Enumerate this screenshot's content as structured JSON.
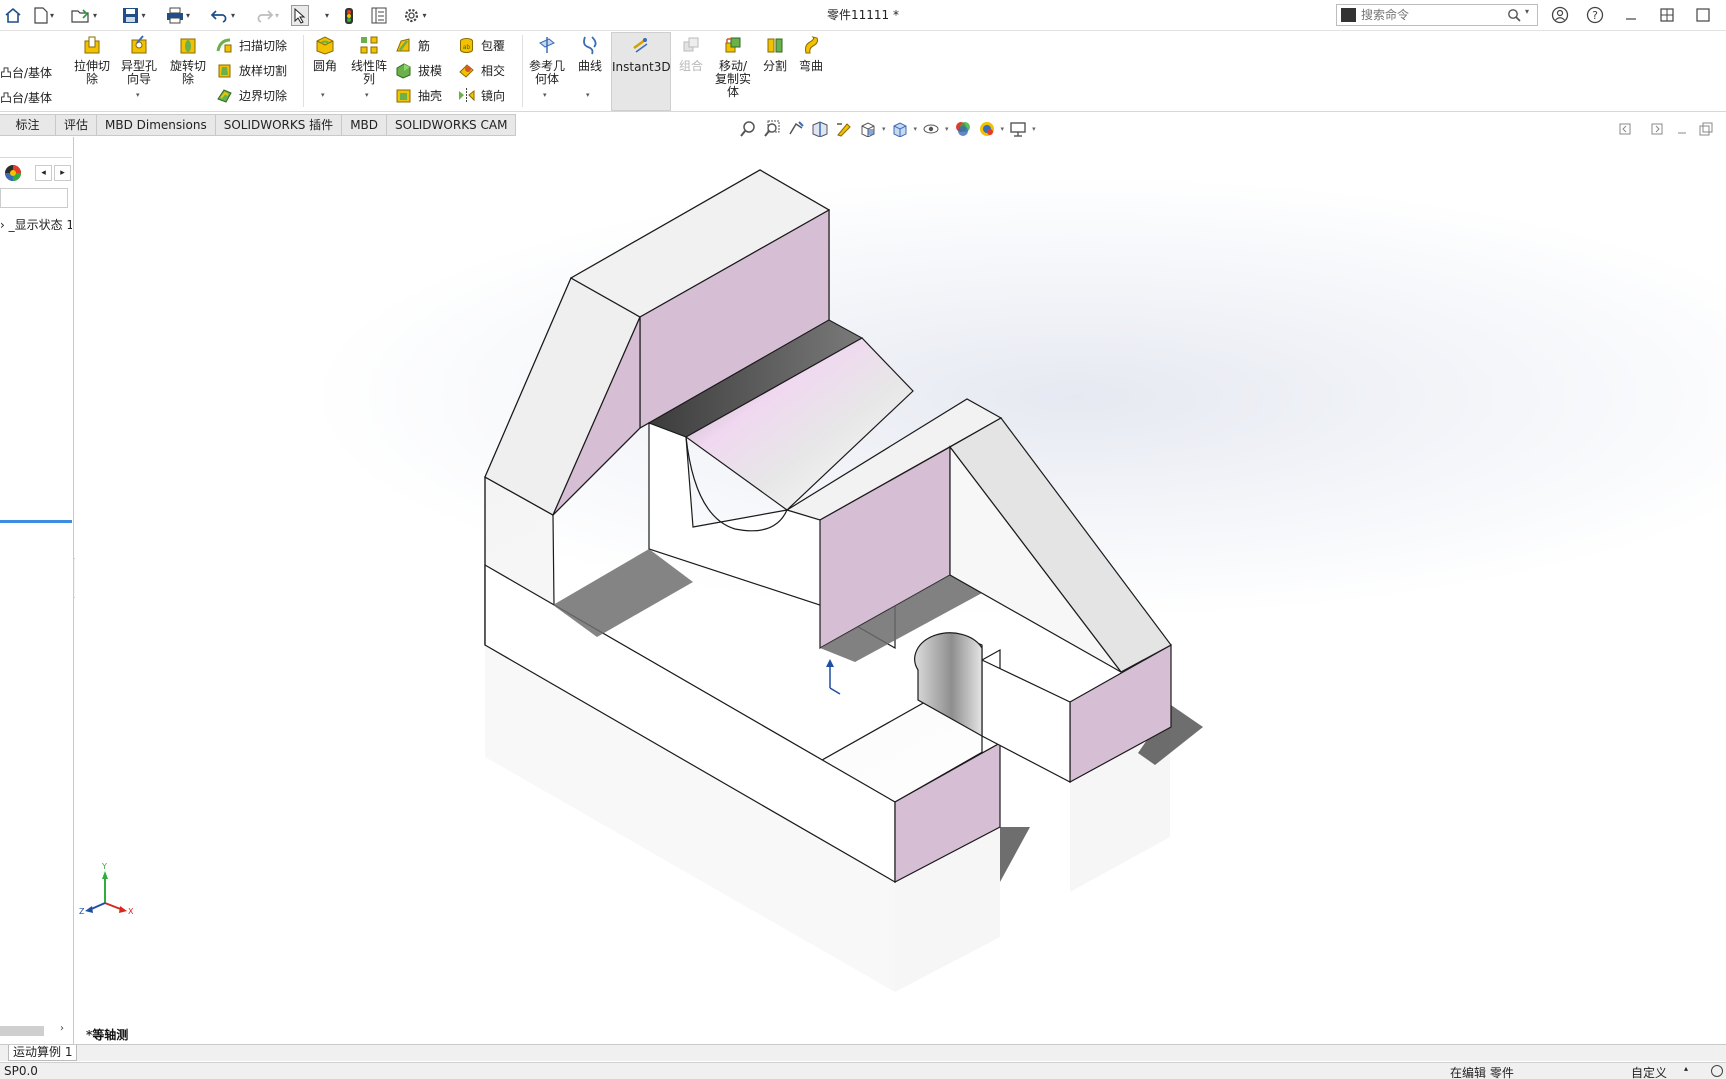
{
  "titlebar": {
    "doc_title": "零件11111 *",
    "search_placeholder": "搜索命令"
  },
  "ribbon": {
    "left_cut": [
      "凸台/基体",
      "凸台/基体"
    ],
    "big_buttons": [
      {
        "label": "拉伸切除",
        "line1": "拉伸切",
        "line2": "除"
      },
      {
        "label": "异型孔向导",
        "line1": "异型孔",
        "line2": "向导"
      },
      {
        "label": "旋转切除",
        "line1": "旋转切",
        "line2": "除"
      }
    ],
    "small_buttons_a": [
      "扫描切除",
      "放样切割",
      "边界切除"
    ],
    "fillet": "圆角",
    "pattern": {
      "line1": "线性阵",
      "line2": "列"
    },
    "small_buttons_b": [
      "筋",
      "拔模",
      "抽壳"
    ],
    "small_buttons_c": [
      "包覆",
      "相交",
      "镜向"
    ],
    "ref_geometry": {
      "line1": "参考几",
      "line2": "何体"
    },
    "curves": "曲线",
    "instant3d": "Instant3D",
    "combine": "组合",
    "move_copy": {
      "line1": "移动/",
      "line2": "复制实",
      "line3": "体"
    },
    "split": "分割",
    "flex": "弯曲"
  },
  "tabs": [
    "标注",
    "评估",
    "MBD Dimensions",
    "SOLIDWORKS 插件",
    "MBD",
    "SOLIDWORKS CAM"
  ],
  "left_panel": {
    "display_state": "› _显示状态 1:"
  },
  "viewport": {
    "view_label": "*等轴测",
    "triad": {
      "x": "X",
      "y": "Y",
      "z": "Z"
    }
  },
  "motion_tab": "运动算例 1",
  "status": {
    "left": "SP0.0",
    "editing": "在编辑 零件",
    "custom": "自定义"
  },
  "colors": {
    "face_pink": "#d6bfd4",
    "face_light": "#efefef",
    "accent_blue": "#3d8de0"
  }
}
